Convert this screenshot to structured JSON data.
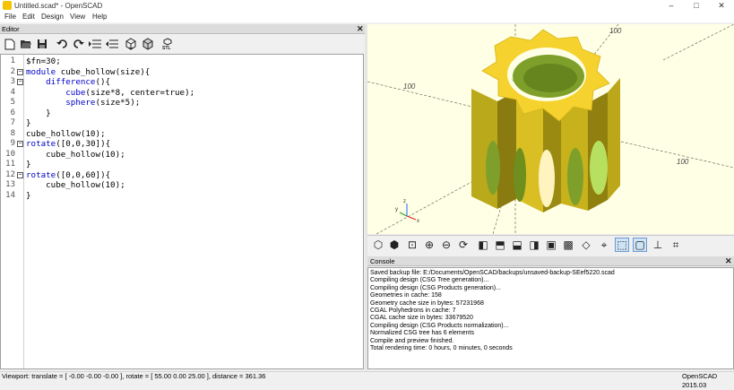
{
  "window": {
    "title": "Untitled.scad* - OpenSCAD",
    "minimize": "–",
    "maximize": "□",
    "close": "✕"
  },
  "menu": [
    "File",
    "Edit",
    "Design",
    "View",
    "Help"
  ],
  "editor": {
    "header": "Editor",
    "close": "✕",
    "toolbar_icons": [
      "new-file-icon",
      "open-file-icon",
      "save-icon",
      "undo-icon",
      "redo-icon",
      "indent-icon",
      "unindent-icon",
      "preview-icon",
      "render-icon",
      "export-stl-icon"
    ],
    "lines": [
      {
        "n": "1",
        "fold": "",
        "text": "$fn=30;"
      },
      {
        "n": "2",
        "fold": "⊟",
        "text": "module cube_hollow(size){"
      },
      {
        "n": "3",
        "fold": "⊟",
        "text": "    difference(){"
      },
      {
        "n": "4",
        "fold": "",
        "text": "        cube(size*8, center=true);"
      },
      {
        "n": "5",
        "fold": "",
        "text": "        sphere(size*5);"
      },
      {
        "n": "6",
        "fold": "",
        "text": "    }"
      },
      {
        "n": "7",
        "fold": "",
        "text": "}"
      },
      {
        "n": "8",
        "fold": "",
        "text": "cube_hollow(10);"
      },
      {
        "n": "9",
        "fold": "⊟",
        "text": "rotate([0,0,30]){"
      },
      {
        "n": "10",
        "fold": "",
        "text": "    cube_hollow(10);"
      },
      {
        "n": "11",
        "fold": "",
        "text": "}"
      },
      {
        "n": "12",
        "fold": "⊟",
        "text": "rotate([0,0,60]){"
      },
      {
        "n": "13",
        "fold": "",
        "text": "    cube_hollow(10);"
      },
      {
        "n": "14",
        "fold": "",
        "text": "}"
      }
    ]
  },
  "viewport": {
    "axis_labels": [
      "100",
      "100",
      "100"
    ],
    "gizmo": {
      "x": "x",
      "y": "y",
      "z": "z"
    },
    "colors": {
      "background": "#ffffe5",
      "model_top": "#f5d22e",
      "model_side": "#c9b41a",
      "model_dark": "#8c7d10",
      "inner": "#7ea02a"
    }
  },
  "view_toolbar_icons": [
    "preview-icon",
    "render-icon",
    "view-all-icon",
    "zoom-in-icon",
    "zoom-out-icon",
    "reset-view-icon",
    "right-view-icon",
    "top-view-icon",
    "bottom-view-icon",
    "left-view-icon",
    "front-view-icon",
    "back-view-icon",
    "diagonal-view-icon",
    "center-icon",
    "perspective-icon",
    "orthogonal-icon",
    "axes-icon",
    "crosshairs-icon"
  ],
  "console": {
    "header": "Console",
    "close": "✕",
    "lines": [
      "Saved backup file: E:/Documents/OpenSCAD/backups/unsaved-backup-SEef5220.scad",
      "Compiling design (CSG Tree generation)...",
      "Compiling design (CSG Products generation)...",
      "Geometries in cache: 158",
      "Geometry cache size in bytes: 57231968",
      "CGAL Polyhedrons in cache: 7",
      "CGAL cache size in bytes: 33679520",
      "Compiling design (CSG Products normalization)...",
      "Normalized CSG tree has 6 elements",
      "Compile and preview finished.",
      "Total rendering time: 0 hours, 0 minutes, 0 seconds"
    ]
  },
  "statusbar": {
    "viewport": "Viewport: translate = [ -0.00 -0.00 -0.00 ], rotate = [ 55.00 0.00 25.00 ], distance = 361.36",
    "version": "OpenSCAD 2015.03"
  }
}
